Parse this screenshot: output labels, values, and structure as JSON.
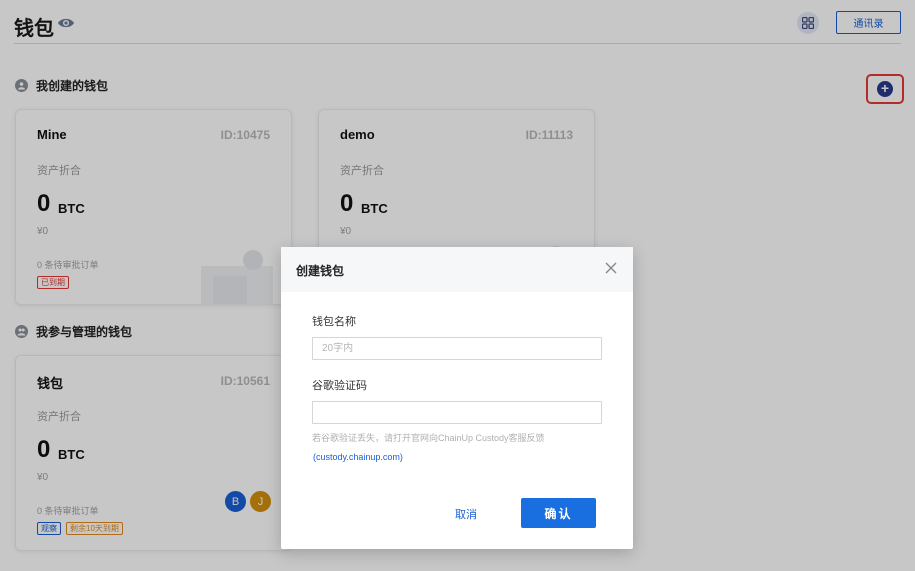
{
  "header": {
    "title": "钱包",
    "address_book_label": "通讯录"
  },
  "sections": {
    "created_label": "我创建的钱包",
    "managed_label": "我参与管理的钱包"
  },
  "cards": [
    {
      "name": "Mine",
      "id": "ID:10475",
      "asset_label": "资产折合",
      "amount": "0",
      "unit": "BTC",
      "cny": "¥0",
      "pending": "0 条待审批订单",
      "badges": [
        "已到期"
      ]
    },
    {
      "name": "demo",
      "id": "ID:11113",
      "asset_label": "资产折合",
      "amount": "0",
      "unit": "BTC",
      "cny": "¥0"
    },
    {
      "name": "钱包",
      "id": "ID:10561",
      "asset_label": "资产折合",
      "amount": "0",
      "unit": "BTC",
      "cny": "¥0",
      "pending": "0 条待审批订单",
      "badges": [
        "观察",
        "剩余10天到期"
      ],
      "avatars": [
        "B",
        "J"
      ]
    }
  ],
  "colors": {
    "accent": "#1a5fd6",
    "expired": "#e53935",
    "warning": "#e08a1e",
    "avatar_b": "#1a5fd6",
    "avatar_j": "#d4900e"
  },
  "icons": {
    "visibility": "eye-icon",
    "apps": "grid-icon",
    "add_wallet": "plus-icon",
    "close": "close-icon",
    "section": "user-icon"
  },
  "modal": {
    "title": "创建钱包",
    "name_label": "钱包名称",
    "name_placeholder": "20字内",
    "name_value": "",
    "code_label": "谷歌验证码",
    "code_value": "",
    "hint": "若谷歌验证丢失，请打开官网向ChainUp Custody客服反馈",
    "hint_link": "(custody.chainup.com)",
    "cancel_label": "取消",
    "confirm_label": "确认"
  }
}
